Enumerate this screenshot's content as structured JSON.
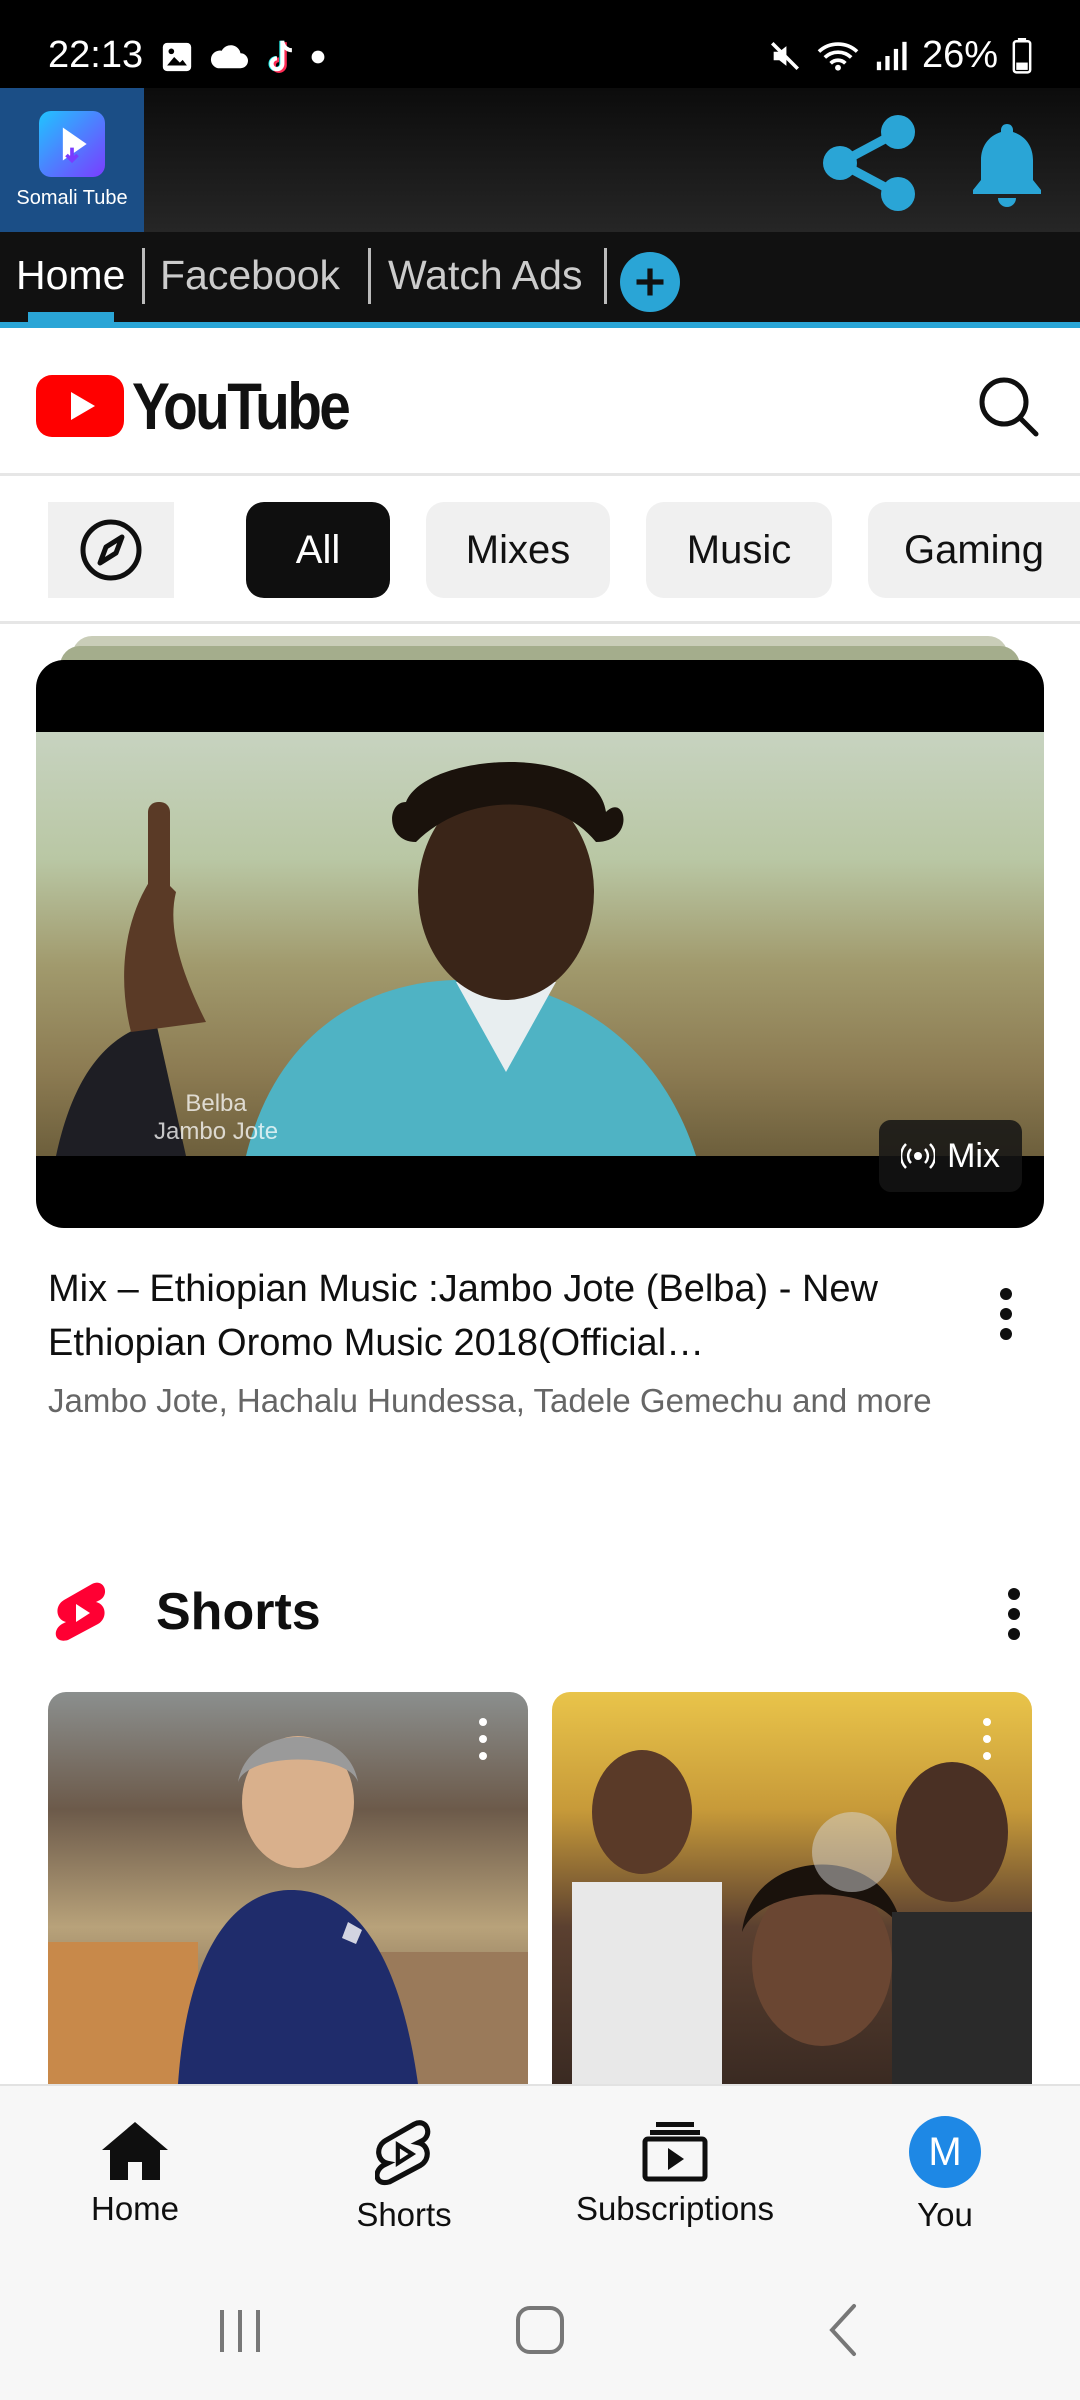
{
  "status": {
    "time": "22:13",
    "battery": "26%",
    "left_icons": [
      "gallery-icon",
      "cloud-icon",
      "tiktok-icon",
      "dot-icon"
    ],
    "right_icons": [
      "mute-icon",
      "wifi-icon",
      "signal-icon",
      "battery-icon"
    ]
  },
  "app": {
    "logo_text": "Somali Tube",
    "share_label": "share",
    "bell_label": "notifications",
    "accent": "#2aa5d6"
  },
  "top_tabs": [
    {
      "label": "Home"
    },
    {
      "label": "Facebook"
    },
    {
      "label": "Watch Ads"
    }
  ],
  "youtube": {
    "logo_text": "YouTube",
    "brand_color": "#ff0000"
  },
  "chips": [
    "All",
    "Mixes",
    "Music",
    "Gaming"
  ],
  "mix": {
    "thumb_caption_line1": "Belba",
    "thumb_caption_line2": "Jambo Jote",
    "badge": "Mix",
    "title": "Mix – Ethiopian Music :Jambo Jote (Belba) - New Ethiopian Oromo Music 2018(Official…",
    "meta": "Jambo Jote, Hachalu Hundessa, Tadele Gemechu and more"
  },
  "shorts": {
    "title": "Shorts"
  },
  "bottom_nav": [
    {
      "label": "Home",
      "icon": "home-icon"
    },
    {
      "label": "Shorts",
      "icon": "shorts-icon"
    },
    {
      "label": "Subscriptions",
      "icon": "subscriptions-icon"
    },
    {
      "label": "You",
      "icon": "avatar",
      "avatar_letter": "M"
    }
  ]
}
